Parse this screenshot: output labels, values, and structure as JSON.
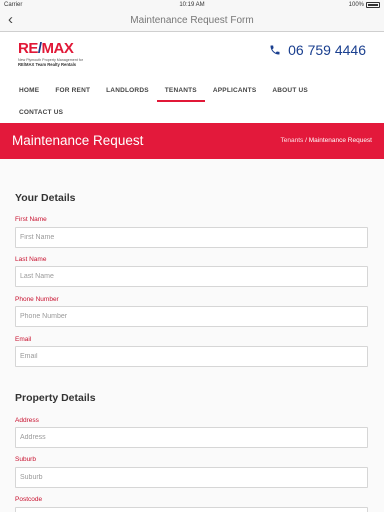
{
  "status_bar": {
    "carrier": "Carrier",
    "time": "10:19 AM",
    "battery": "100%"
  },
  "nav": {
    "back_icon": "chevron-left-icon",
    "title": "Maintenance Request Form"
  },
  "logo": {
    "brand": "RE/MAX",
    "tagline": "New Plymouth Property Management for",
    "tagline2": "RE/MAX Team Realty Rentals"
  },
  "phone": {
    "icon": "phone-icon",
    "number": "06 759 4446",
    "color": "#1a3f8f"
  },
  "menu": {
    "items": [
      {
        "label": "HOME"
      },
      {
        "label": "FOR RENT"
      },
      {
        "label": "LANDLORDS"
      },
      {
        "label": "TENANTS"
      },
      {
        "label": "APPLICANTS"
      },
      {
        "label": "ABOUT US"
      }
    ],
    "second_row": [
      {
        "label": "CONTACT US"
      }
    ],
    "active": "TENANTS"
  },
  "banner": {
    "title": "Maintenance Request",
    "crumb_link": "Tenants",
    "crumb_sep": "/",
    "crumb_current": "Maintenance Request",
    "color": "#e3193b"
  },
  "form": {
    "your_details": {
      "heading": "Your Details",
      "fields": [
        {
          "label": "First Name",
          "placeholder": "First Name",
          "value": ""
        },
        {
          "label": "Last Name",
          "placeholder": "Last Name",
          "value": ""
        },
        {
          "label": "Phone Number",
          "placeholder": "Phone Number",
          "value": ""
        },
        {
          "label": "Email",
          "placeholder": "Email",
          "value": ""
        }
      ]
    },
    "property_details": {
      "heading": "Property Details",
      "fields": [
        {
          "label": "Address",
          "placeholder": "Address",
          "value": ""
        },
        {
          "label": "Suburb",
          "placeholder": "Suburb",
          "value": ""
        },
        {
          "label": "Postcode",
          "placeholder": "Postcode",
          "value": ""
        }
      ]
    }
  }
}
